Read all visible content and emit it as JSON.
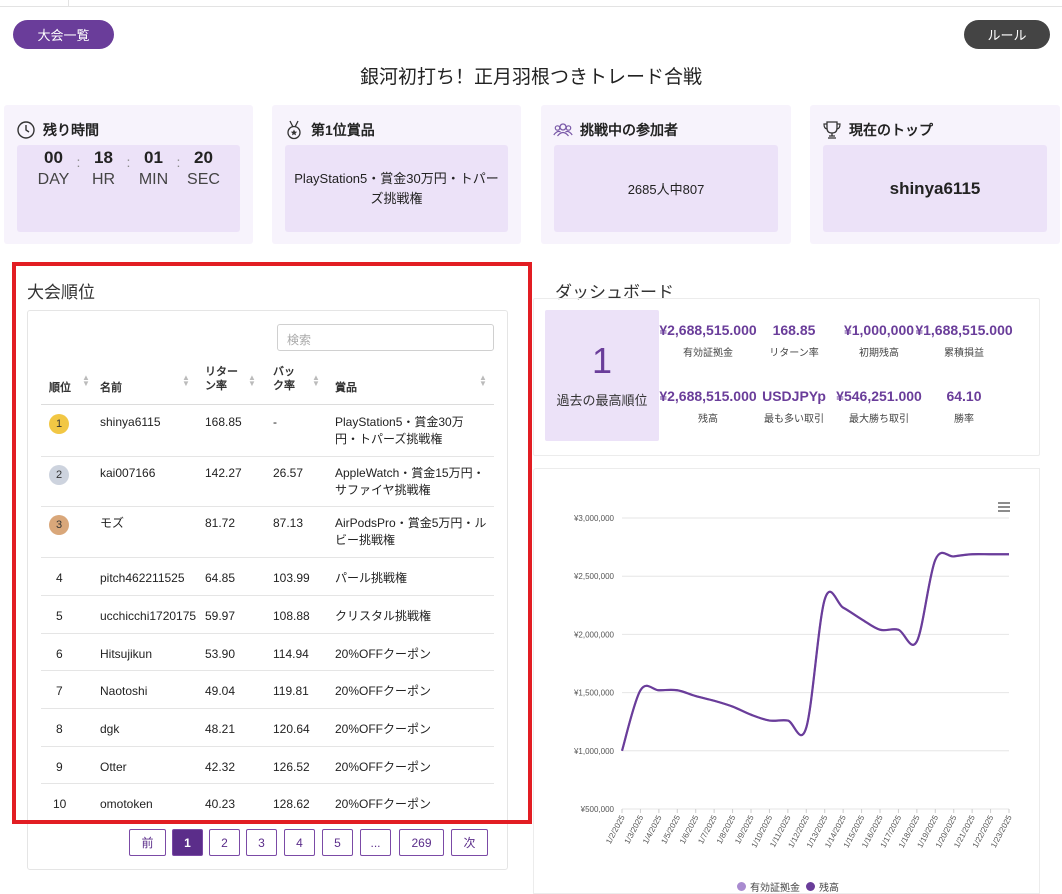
{
  "header": {
    "back_label": "大会一覧",
    "rules_label": "ルール",
    "title": "銀河初打ち！正月羽根つきトレード合戦"
  },
  "cards": {
    "time_left": {
      "title": "残り時間",
      "units": [
        {
          "value": "00",
          "label": "DAY"
        },
        {
          "value": "18",
          "label": "HR"
        },
        {
          "value": "01",
          "label": "MIN"
        },
        {
          "value": "20",
          "label": "SEC"
        }
      ]
    },
    "first_prize": {
      "title": "第1位賞品",
      "value": "PlayStation5・賞金30万円・トパーズ挑戦権"
    },
    "participants": {
      "title": "挑戦中の参加者",
      "value": "2685人中807"
    },
    "current_top": {
      "title": "現在のトップ",
      "value": "shinya6115"
    }
  },
  "ranking": {
    "title": "大会順位",
    "search_placeholder": "検索",
    "columns": [
      "順位",
      "名前",
      "リター ン率",
      "バッ ク率",
      "賞品"
    ],
    "rows": [
      {
        "rank": "1",
        "name": "shinya6115",
        "return": "168.85",
        "back": "-",
        "prize": "PlayStation5・賞金30万円・トパーズ挑戦権",
        "medal": "gold"
      },
      {
        "rank": "2",
        "name": "kai007166",
        "return": "142.27",
        "back": "26.57",
        "prize": "AppleWatch・賞金15万円・サファイヤ挑戦権",
        "medal": "silver"
      },
      {
        "rank": "3",
        "name": "モズ",
        "return": "81.72",
        "back": "87.13",
        "prize": "AirPodsPro・賞金5万円・ルビー挑戦権",
        "medal": "bronze"
      },
      {
        "rank": "4",
        "name": "pitch462211525",
        "return": "64.85",
        "back": "103.99",
        "prize": "パール挑戦権",
        "medal": ""
      },
      {
        "rank": "5",
        "name": "ucchicchi1720175",
        "return": "59.97",
        "back": "108.88",
        "prize": "クリスタル挑戦権",
        "medal": ""
      },
      {
        "rank": "6",
        "name": "Hitsujikun",
        "return": "53.90",
        "back": "114.94",
        "prize": "20%OFFクーポン",
        "medal": ""
      },
      {
        "rank": "7",
        "name": "Naotoshi",
        "return": "49.04",
        "back": "119.81",
        "prize": "20%OFFクーポン",
        "medal": ""
      },
      {
        "rank": "8",
        "name": "dgk",
        "return": "48.21",
        "back": "120.64",
        "prize": "20%OFFクーポン",
        "medal": ""
      },
      {
        "rank": "9",
        "name": "Otter",
        "return": "42.32",
        "back": "126.52",
        "prize": "20%OFFクーポン",
        "medal": ""
      },
      {
        "rank": "10",
        "name": "omotoken",
        "return": "40.23",
        "back": "128.62",
        "prize": "20%OFFクーポン",
        "medal": ""
      }
    ],
    "pagination": [
      "前",
      "1",
      "2",
      "3",
      "4",
      "5",
      "...",
      "269",
      "次"
    ],
    "current_page": "1"
  },
  "dashboard": {
    "title": "ダッシュボード",
    "best_rank": {
      "value": "1",
      "label": "過去の最高順位"
    },
    "metrics": [
      {
        "value": "¥2,688,515.000",
        "label": "有効証拠金"
      },
      {
        "value": "168.85",
        "label": "リターン率"
      },
      {
        "value": "¥1,000,000",
        "label": "初期残高"
      },
      {
        "value": "¥1,688,515.000",
        "label": "累積損益"
      },
      {
        "value": "¥2,688,515.000",
        "label": "残高"
      },
      {
        "value": "USDJPYp",
        "label": "最も多い取引"
      },
      {
        "value": "¥546,251.000",
        "label": "最大勝ち取引"
      },
      {
        "value": "64.10",
        "label": "勝率"
      }
    ]
  },
  "chart_data": {
    "type": "line",
    "title": "",
    "xlabel": "",
    "ylabel": "",
    "ylim": [
      500000,
      3000000
    ],
    "y_ticks": [
      "¥500,000",
      "¥1,000,000",
      "¥1,500,000",
      "¥2,000,000",
      "¥2,500,000",
      "¥3,000,000"
    ],
    "y_tick_values": [
      500000,
      1000000,
      1500000,
      2000000,
      2500000,
      3000000
    ],
    "x": [
      "1/2/2025",
      "1/3/2025",
      "1/4/2025",
      "1/5/2025",
      "1/6/2025",
      "1/7/2025",
      "1/8/2025",
      "1/9/2025",
      "1/10/2025",
      "1/11/2025",
      "1/12/2025",
      "1/13/2025",
      "1/14/2025",
      "1/15/2025",
      "1/16/2025",
      "1/17/2025",
      "1/18/2025",
      "1/19/2025",
      "1/20/2025",
      "1/21/2025",
      "1/22/2025",
      "1/23/2025"
    ],
    "series": [
      {
        "name": "有効証拠金",
        "color": "#a98bd0",
        "values": [
          1000000,
          1520000,
          1520000,
          1520000,
          1470000,
          1430000,
          1380000,
          1310000,
          1260000,
          1260000,
          1200000,
          2300000,
          2230000,
          2130000,
          2040000,
          2040000,
          1940000,
          2640000,
          2670000,
          2688515,
          2688515,
          2688515
        ]
      },
      {
        "name": "残高",
        "color": "#6a3d9a",
        "values": [
          1000000,
          1520000,
          1520000,
          1520000,
          1470000,
          1430000,
          1380000,
          1310000,
          1260000,
          1260000,
          1200000,
          2300000,
          2230000,
          2130000,
          2040000,
          2040000,
          1940000,
          2640000,
          2670000,
          2688515,
          2688515,
          2688515
        ]
      }
    ],
    "grid": true,
    "legend": "bottom",
    "menu_icon": "hamburger-menu-icon"
  }
}
